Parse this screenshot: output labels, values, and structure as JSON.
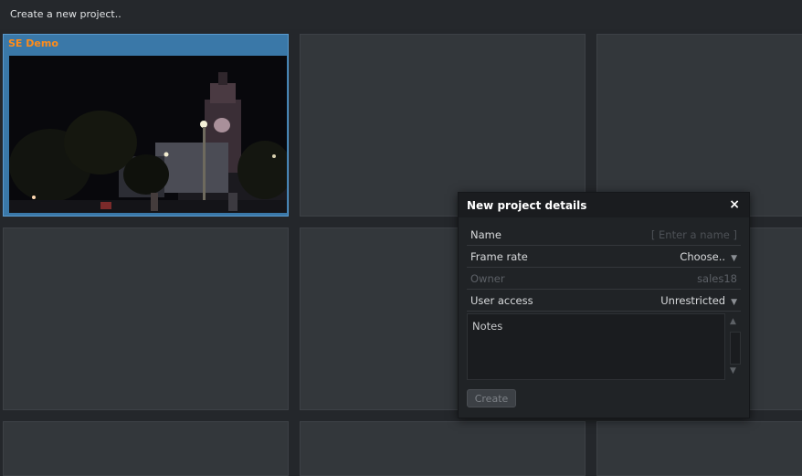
{
  "header": {
    "title": "Create a new project.."
  },
  "projects": [
    {
      "label": "SE Demo"
    }
  ],
  "dialog": {
    "title": "New project details",
    "close": "×",
    "fields": {
      "name": {
        "label": "Name",
        "placeholder": "[ Enter a name ]"
      },
      "frame_rate": {
        "label": "Frame rate",
        "value": "Choose.."
      },
      "owner": {
        "label": "Owner",
        "value": "sales18"
      },
      "user_access": {
        "label": "User access",
        "value": "Unrestricted"
      }
    },
    "notes_placeholder": "Notes",
    "create_label": "Create"
  },
  "colors": {
    "accent": "#3a78a8",
    "project_label": "#ff8c1a",
    "background": "#24272b"
  },
  "icons": {
    "close": "close-icon",
    "dropdown": "chevron-down-icon",
    "scroll_up": "triangle-up-icon",
    "scroll_down": "triangle-down-icon"
  }
}
